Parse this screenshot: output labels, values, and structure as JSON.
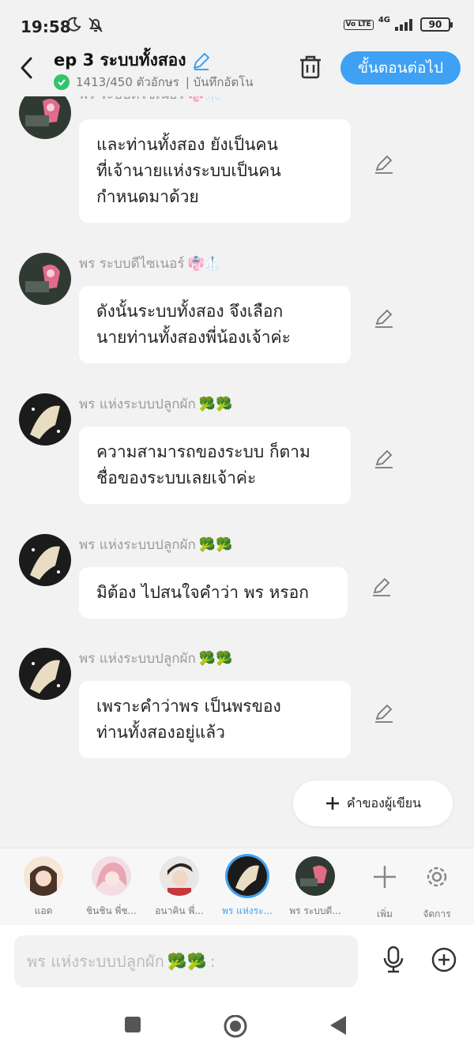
{
  "status_bar": {
    "time": "19:58",
    "network": "4G",
    "volte": "Vo LTE",
    "battery": "90"
  },
  "header": {
    "title": "ep 3 ระบบทั้งสอง",
    "char_count": "1413/450 ตัวอักษร",
    "autosave": "| บันทึกอัตโน",
    "next_button": "ขั้นตอนต่อไป"
  },
  "messages": [
    {
      "sender": "พร ระบบดีไซเนอร์",
      "sender_emoji": "👘🥼",
      "avatar": "designer-avatar",
      "lines": [
        "และท่านทั้งสอง ยังเป็นคน",
        "ที่เจ้านายแห่งระบบเป็นคน",
        "กำหนดมาด้วย"
      ]
    },
    {
      "sender": "พร ระบบดีไซเนอร์",
      "sender_emoji": "👘🥼",
      "avatar": "designer-avatar",
      "lines": [
        "ดังนั้นระบบทั้งสอง จึงเลือก",
        "นายท่านทั้งสองพี่น้องเจ้าค่ะ"
      ]
    },
    {
      "sender": "พร แห่งระบบปลูกผัก",
      "sender_emoji": "🥦🥦",
      "avatar": "farm-avatar",
      "lines": [
        "ความสามารถของระบบ ก็ตาม",
        "ชื่อของระบบเลยเจ้าค่ะ"
      ]
    },
    {
      "sender": "พร แห่งระบบปลูกผัก",
      "sender_emoji": "🥦🥦",
      "avatar": "farm-avatar",
      "lines": [
        "มิต้อง ไปสนใจคำว่า พร หรอก"
      ]
    },
    {
      "sender": "พร แห่งระบบปลูกผัก",
      "sender_emoji": "🥦🥦",
      "avatar": "farm-avatar",
      "lines": [
        "เพราะคำว่าพร เป็นพรของ",
        "ท่านทั้งสองอยู่แล้ว"
      ]
    }
  ],
  "author_button": "คำของผู้เขียน",
  "characters": [
    {
      "label": "แอด",
      "icon": "girl-avatar"
    },
    {
      "label": "ชินชิน พี่ช...",
      "icon": "pink-hair-avatar"
    },
    {
      "label": "อนาคิน พี่...",
      "icon": "boy-avatar"
    },
    {
      "label": "พร แห่งระ...",
      "icon": "farm-avatar",
      "active": true
    },
    {
      "label": "พร ระบบดี...",
      "icon": "designer-avatar"
    }
  ],
  "char_actions": {
    "add": "เพิ่ม",
    "manage": "จัดการ"
  },
  "input": {
    "placeholder": "พร แห่งระบบปลูกผัก",
    "emoji": "🥦🥦",
    "suffix": ":"
  },
  "colors": {
    "accent": "#3fa1f3",
    "check": "#34c36b",
    "background": "#f2f2f2"
  }
}
